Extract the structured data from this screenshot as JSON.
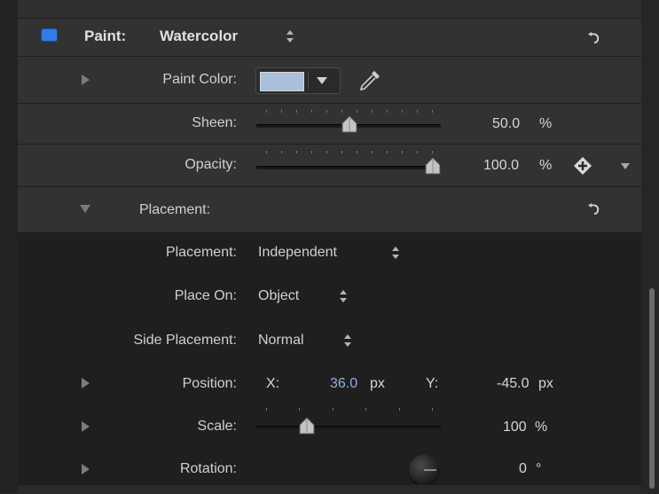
{
  "header": {
    "section_label": "Paint:",
    "section_value": "Watercolor"
  },
  "paint_color": {
    "label": "Paint Color:",
    "swatch_color": "#a9bfdc"
  },
  "sheen": {
    "label": "Sheen:",
    "value": "50.0",
    "unit": "%",
    "level": 0.5
  },
  "opacity": {
    "label": "Opacity:",
    "value": "100.0",
    "unit": "%",
    "level": 1.0
  },
  "placement_group": {
    "label": "Placement:"
  },
  "placement": {
    "label": "Placement:",
    "value": "Independent"
  },
  "place_on": {
    "label": "Place On:",
    "value": "Object"
  },
  "side_placement": {
    "label": "Side Placement:",
    "value": "Normal"
  },
  "position": {
    "label": "Position:",
    "x_label": "X:",
    "x_value": "36.0",
    "x_unit": "px",
    "y_label": "Y:",
    "y_value": "-45.0",
    "y_unit": "px"
  },
  "scale": {
    "label": "Scale:",
    "value": "100",
    "unit": "%"
  },
  "rotation": {
    "label": "Rotation:",
    "value": "0",
    "unit": "°"
  },
  "colors": {
    "accent": "#2f7dea",
    "value_blue": "#8fb0df"
  }
}
